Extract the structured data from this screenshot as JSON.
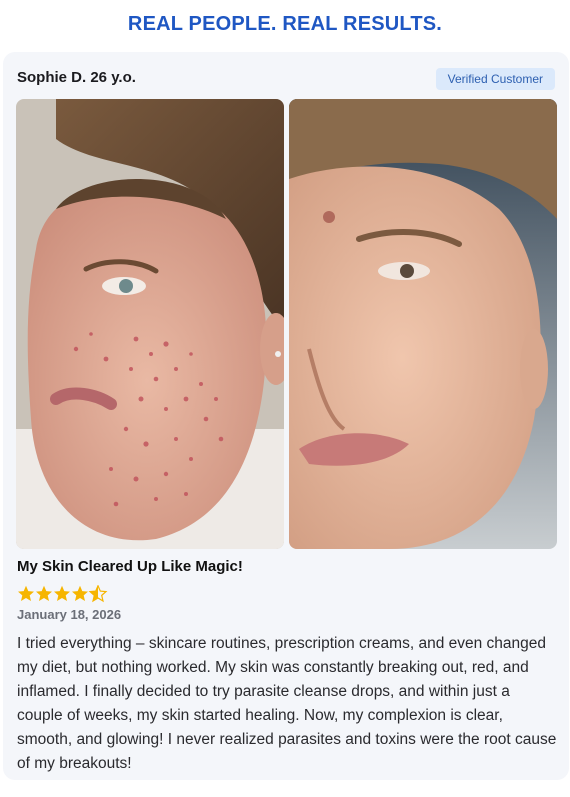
{
  "headline": "REAL PEOPLE. REAL RESULTS.",
  "review": {
    "author": "Sophie D. 26 y.o.",
    "badge": "Verified Customer",
    "title": "My Skin Cleared Up Like Magic!",
    "rating": 4.5,
    "rating_max": 5,
    "date": "January 18, 2026",
    "text": "I tried everything – skincare routines, prescription creams, and even changed my diet, but nothing worked. My skin was constantly breaking out, red, and inflamed. I finally decided to try parasite cleanse drops, and within just a couple of weeks, my skin started healing. Now, my complexion is clear, smooth, and glowing! I never realized parasites and toxins were the root cause of my breakouts!"
  },
  "colors": {
    "headline": "#1f57c3",
    "star": "#f6b500",
    "badge_bg": "#dbe9fb",
    "badge_text": "#2d5fb0"
  },
  "images": [
    "before-photo",
    "after-photo"
  ]
}
